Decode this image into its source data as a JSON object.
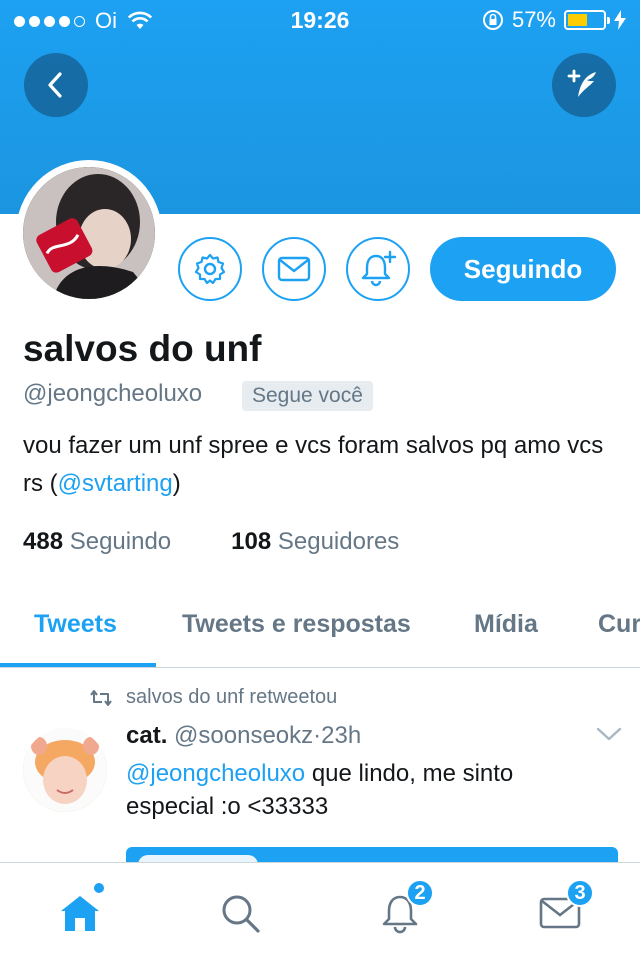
{
  "status_bar": {
    "carrier": "Oi",
    "time": "19:26",
    "battery": "57%",
    "battery_level": 0.57
  },
  "header": {
    "back_icon": "chevron-left-icon",
    "compose_icon": "compose-tweet-icon"
  },
  "profile": {
    "name": "salvos do unf",
    "handle": "@jeongcheoluxo",
    "follows_you": "Segue você",
    "bio_text": "vou fazer um unf spree e vcs foram salvos pq amo vcs rs (",
    "bio_link": "@svtarting",
    "bio_end": ")",
    "following_count": "488",
    "following_label": "Seguindo",
    "followers_count": "108",
    "followers_label": "Seguidores",
    "follow_button": "Seguindo"
  },
  "tabs": [
    {
      "label": "Tweets",
      "active": true
    },
    {
      "label": "Tweets e respostas",
      "active": false
    },
    {
      "label": "Mídia",
      "active": false
    },
    {
      "label": "Cur",
      "active": false
    }
  ],
  "tweet": {
    "retweet_line": "salvos do unf retweetou",
    "author_name": "cat.",
    "author_handle": "@soonseokz",
    "separator": "·",
    "time": "23h",
    "mention": "@jeongcheoluxo",
    "text": " que lindo, me sinto especial :o <33333"
  },
  "bottom_nav": {
    "notifications_badge": "2",
    "messages_badge": "3"
  },
  "colors": {
    "accent": "#1da1f2",
    "text": "#14171a",
    "muted": "#657786"
  }
}
